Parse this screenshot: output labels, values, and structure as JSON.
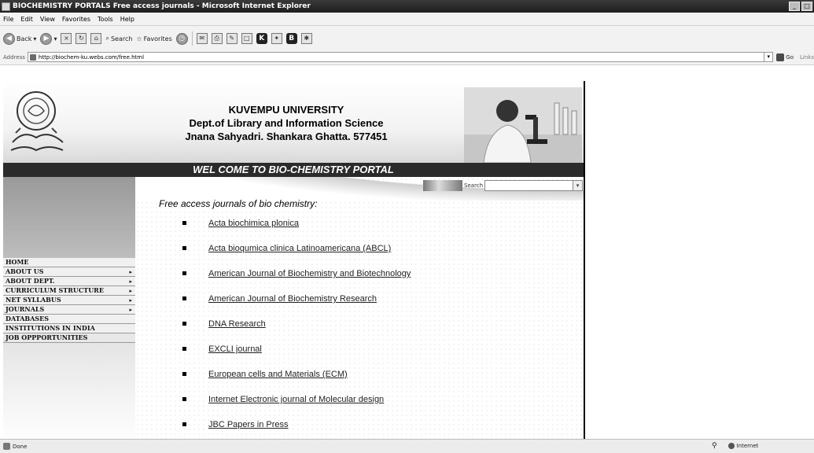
{
  "window": {
    "title": "BIOCHEMISTRY PORTALS Free access journals - Microsoft Internet Explorer"
  },
  "menubar": {
    "items": [
      "File",
      "Edit",
      "View",
      "Favorites",
      "Tools",
      "Help"
    ]
  },
  "toolbar": {
    "back_label": "Back",
    "search_label": "Search",
    "favorites_label": "Favorites"
  },
  "addressbar": {
    "label": "Address",
    "url": "http://biochem-ku.webs.com/free.html",
    "go_label": "Go",
    "links_label": "Links"
  },
  "header": {
    "university": "KUVEMPU UNIVERSITY",
    "department": "Dept.of Library and Information Science",
    "address": "Jnana Sahyadri. Shankara Ghatta. 577451",
    "banner": "WEL COME TO BIO-CHEMISTRY PORTAL"
  },
  "sidebar": {
    "nav": [
      {
        "label": "HOME",
        "arrow": ""
      },
      {
        "label": "ABOUT US",
        "arrow": "▸"
      },
      {
        "label": "ABOUT DEPT.",
        "arrow": "▸"
      },
      {
        "label": "CURRICULUM STRUCTURE",
        "arrow": "▸"
      },
      {
        "label": "NET SYLLABUS",
        "arrow": "▸"
      },
      {
        "label": "JOURNALS",
        "arrow": "▸"
      },
      {
        "label": "DATABASES",
        "arrow": ""
      },
      {
        "label": "INSTITUTIONS IN INDIA",
        "arrow": ""
      },
      {
        "label": "JOB OPPPORTUNITIES",
        "arrow": ""
      }
    ]
  },
  "main": {
    "search_label": "Search",
    "heading": "Free access journals of bio chemistry:",
    "journals": [
      "Acta biochimica plonica",
      "Acta bioqumica clinica Latinoamericana (ABCL)",
      "American Journal of Biochemistry and Biotechnology",
      "American Journal of Biochemistry Research",
      "DNA Research",
      "EXCLI journal",
      "European cells and Materials (ECM)",
      "Internet Electronic journal of Molecular design",
      "JBC Papers in Press"
    ]
  },
  "statusbar": {
    "status": "Done",
    "zone": "Internet"
  }
}
